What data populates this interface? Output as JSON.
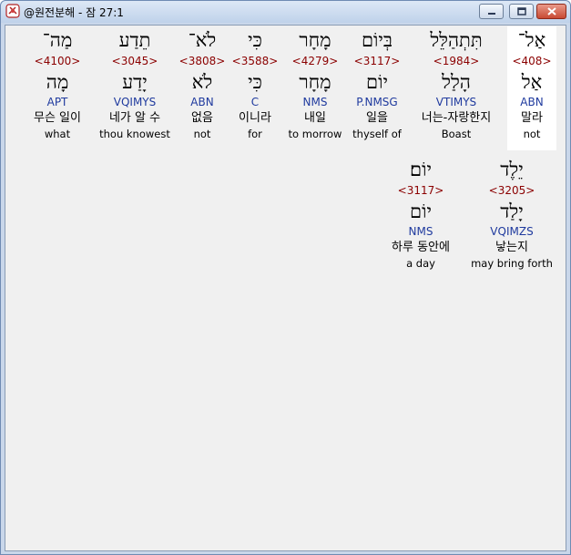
{
  "window": {
    "title": "@원전분해 - 잠 27:1"
  },
  "row1": [
    {
      "heb": "אַל־",
      "strong": "<408>",
      "lex": "אַל",
      "morph": "ABN",
      "kor": "말라",
      "eng": "not",
      "selected": true
    },
    {
      "heb": "תִּתְהַלֵּל",
      "strong": "<1984>",
      "lex": "הָלַל",
      "morph": "VTIMYS",
      "kor": "너는-자랑한지",
      "eng": "Boast"
    },
    {
      "heb": "בְּיוֹם",
      "strong": "<3117>",
      "lex": "יוֹם",
      "morph": "P.NMSG",
      "kor": "일을",
      "eng": "thyself of"
    },
    {
      "heb": "מָחָר",
      "strong": "<4279>",
      "lex": "מָחָר",
      "morph": "NMS",
      "kor": "내일",
      "eng": "to morrow"
    },
    {
      "heb": "כִּי",
      "strong": "<3588>",
      "lex": "כִּי",
      "morph": "C",
      "kor": "이니라",
      "eng": "for"
    },
    {
      "heb": "לֹא־",
      "strong": "<3808>",
      "lex": "לֹא",
      "morph": "ABN",
      "kor": "없음",
      "eng": "not"
    },
    {
      "heb": "תֵדַע",
      "strong": "<3045>",
      "lex": "יָדַע",
      "morph": "VQIMYS",
      "kor": "네가 알 수",
      "eng": "thou knowest"
    },
    {
      "heb": "מַה־",
      "strong": "<4100>",
      "lex": "מָה",
      "morph": "APT",
      "kor": "무슨 일이",
      "eng": "what"
    }
  ],
  "row2": [
    {
      "heb": "יֵלֶד",
      "strong": "<3205>",
      "lex": "יָלַד",
      "morph": "VQIMZS",
      "kor": "낳는지",
      "eng": "may bring forth"
    },
    {
      "heb": "יוֹם׃",
      "strong": "<3117>",
      "lex": "יוֹם",
      "morph": "NMS",
      "kor": "하루 동안에",
      "eng": "a day"
    }
  ]
}
